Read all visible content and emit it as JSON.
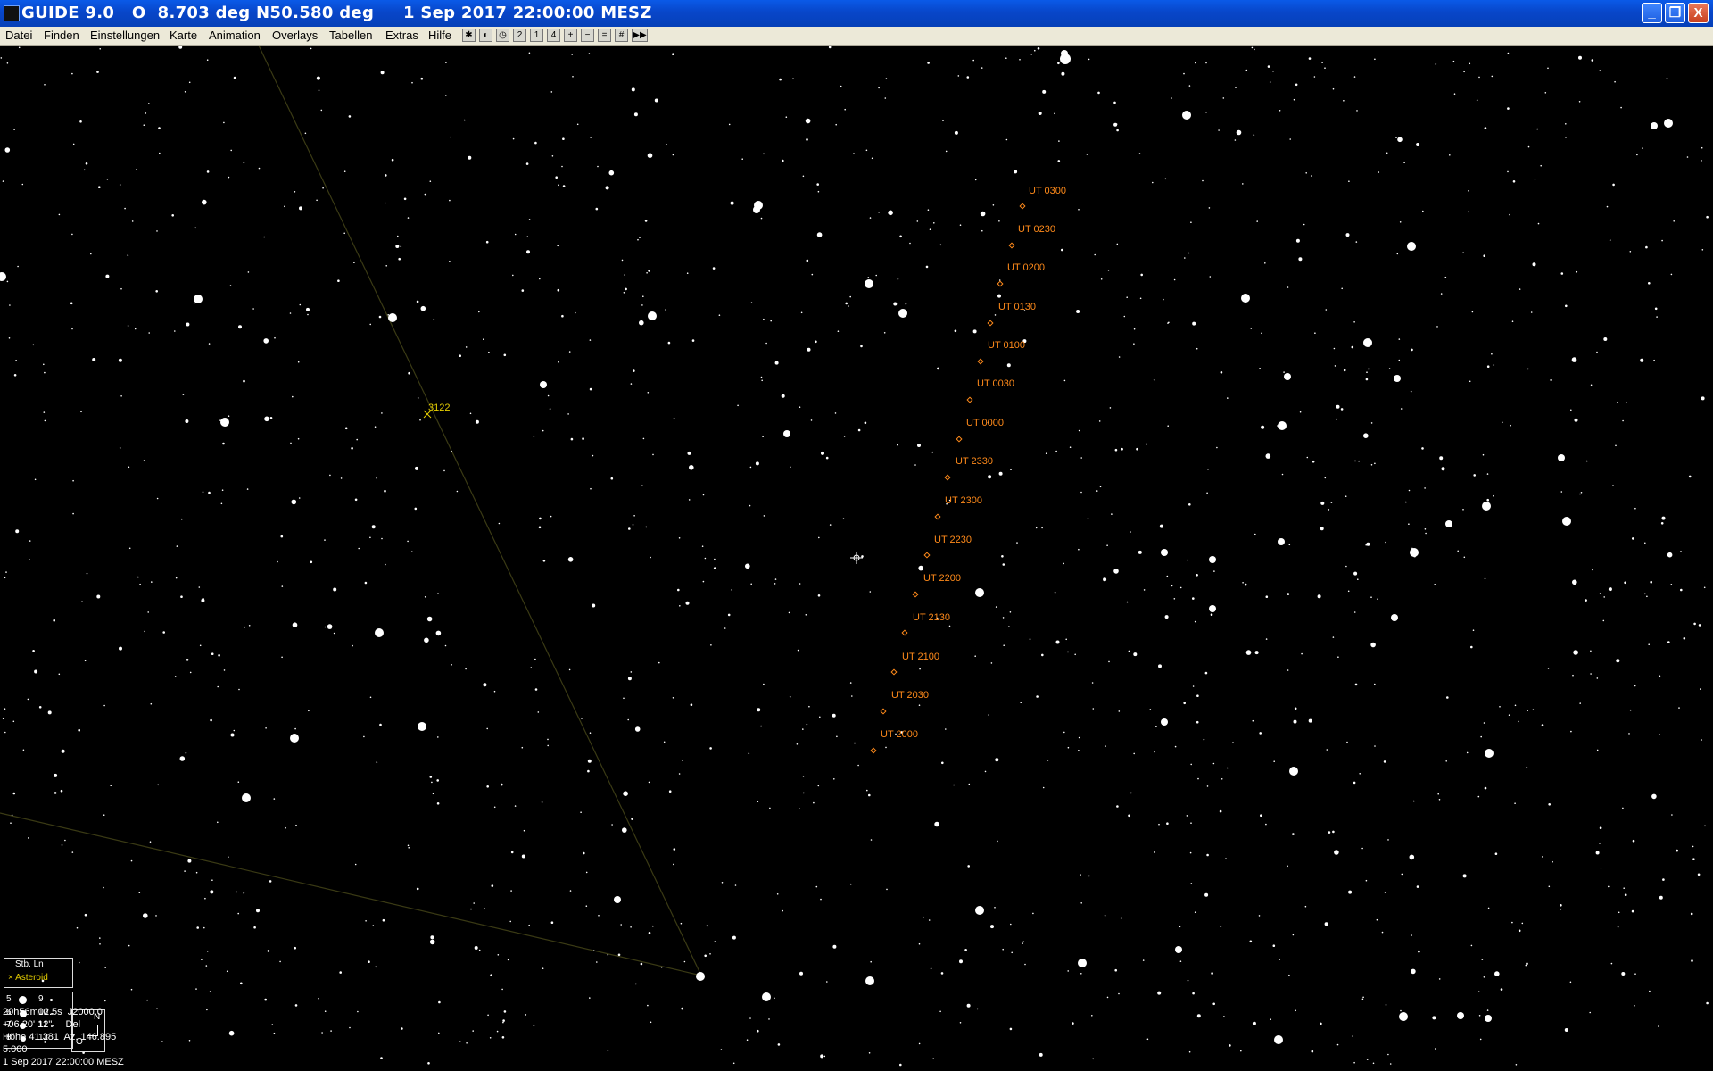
{
  "window": {
    "title": "GUIDE 9.0   O  8.703 deg N50.580 deg     1 Sep 2017 22:00:00 MESZ",
    "minimize": "_",
    "restore": "❐",
    "close": "X"
  },
  "menu": [
    "Datei",
    "Finden",
    "Einstellungen",
    "Karte",
    "Animation",
    "Overlays",
    "Tabellen",
    "Extras",
    "Hilfe"
  ],
  "toolbar": [
    {
      "icon": "star-chart-icon",
      "glyph": "✱"
    },
    {
      "icon": "planet-icon",
      "glyph": "◐"
    },
    {
      "icon": "clock-icon",
      "glyph": "◷"
    },
    {
      "icon": "zoom-2-icon",
      "glyph": "2"
    },
    {
      "icon": "zoom-1-icon",
      "glyph": "1"
    },
    {
      "icon": "zoom-4-icon",
      "glyph": "4"
    },
    {
      "icon": "zoom-in-icon",
      "glyph": "+"
    },
    {
      "icon": "zoom-out-icon",
      "glyph": "−"
    },
    {
      "icon": "zoom-reset-icon",
      "glyph": "="
    },
    {
      "icon": "grid-icon",
      "glyph": "#"
    },
    {
      "icon": "fast-forward-icon",
      "glyph": "▶▶"
    }
  ],
  "colors": {
    "track": "#ff8a1a",
    "asteroid": "#e8d000",
    "boundary": "#3a3a14"
  },
  "asteroid": {
    "name": "3122"
  },
  "track_labels": [
    "UT 0300",
    "UT 0230",
    "UT 0200",
    "UT 0130",
    "UT 0100",
    "UT 0030",
    "UT 0000",
    "UT 2330",
    "UT 2300",
    "UT 2230",
    "UT 2200",
    "UT 2130",
    "UT 2100",
    "UT 2030",
    "UT 2000"
  ],
  "legend": {
    "title": "Stb. Ln",
    "asteroid": "Asteroid"
  },
  "magnitudes": [
    {
      "left": "5",
      "right": "9"
    },
    {
      "left": "6",
      "right": "10"
    },
    {
      "left": "7",
      "right": "11"
    },
    {
      "left": "8",
      "right": "12"
    }
  ],
  "compass": {
    "north": "N",
    "east": "O"
  },
  "info": {
    "coords": "20h56m02.5s  J2000.0",
    "dec": "+06 20' 12\"     Del",
    "altaz": "Höhe 41.381  Az. 146.895",
    "fov": "5.000",
    "date": "1 Sep 2017 22:00:00 MESZ"
  }
}
